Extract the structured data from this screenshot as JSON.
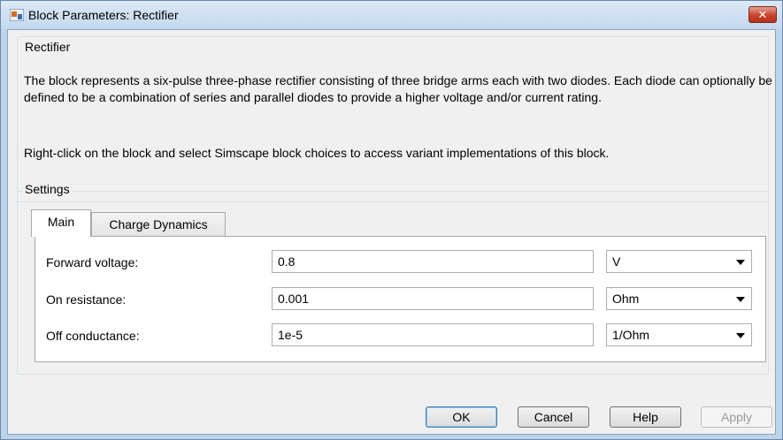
{
  "window": {
    "title": "Block Parameters: Rectifier",
    "close_label": "✕"
  },
  "rectifier_group": {
    "title": "Rectifier",
    "description": "The block represents a six-pulse three-phase rectifier consisting of three bridge arms each with two diodes. Each diode can optionally be defined to be a combination of series and parallel diodes to provide a higher voltage and/or current rating.",
    "note": "Right-click on the block and select Simscape block choices to access variant implementations of this block."
  },
  "settings": {
    "title": "Settings",
    "tabs": [
      {
        "label": "Main",
        "selected": true
      },
      {
        "label": "Charge Dynamics",
        "selected": false
      }
    ],
    "params": [
      {
        "label": "Forward voltage:",
        "value": "0.8",
        "unit": "V"
      },
      {
        "label": "On resistance:",
        "value": "0.001",
        "unit": "Ohm"
      },
      {
        "label": "Off conductance:",
        "value": "1e-5",
        "unit": "1/Ohm"
      }
    ]
  },
  "buttons": {
    "ok": "OK",
    "cancel": "Cancel",
    "help": "Help",
    "apply": "Apply"
  }
}
